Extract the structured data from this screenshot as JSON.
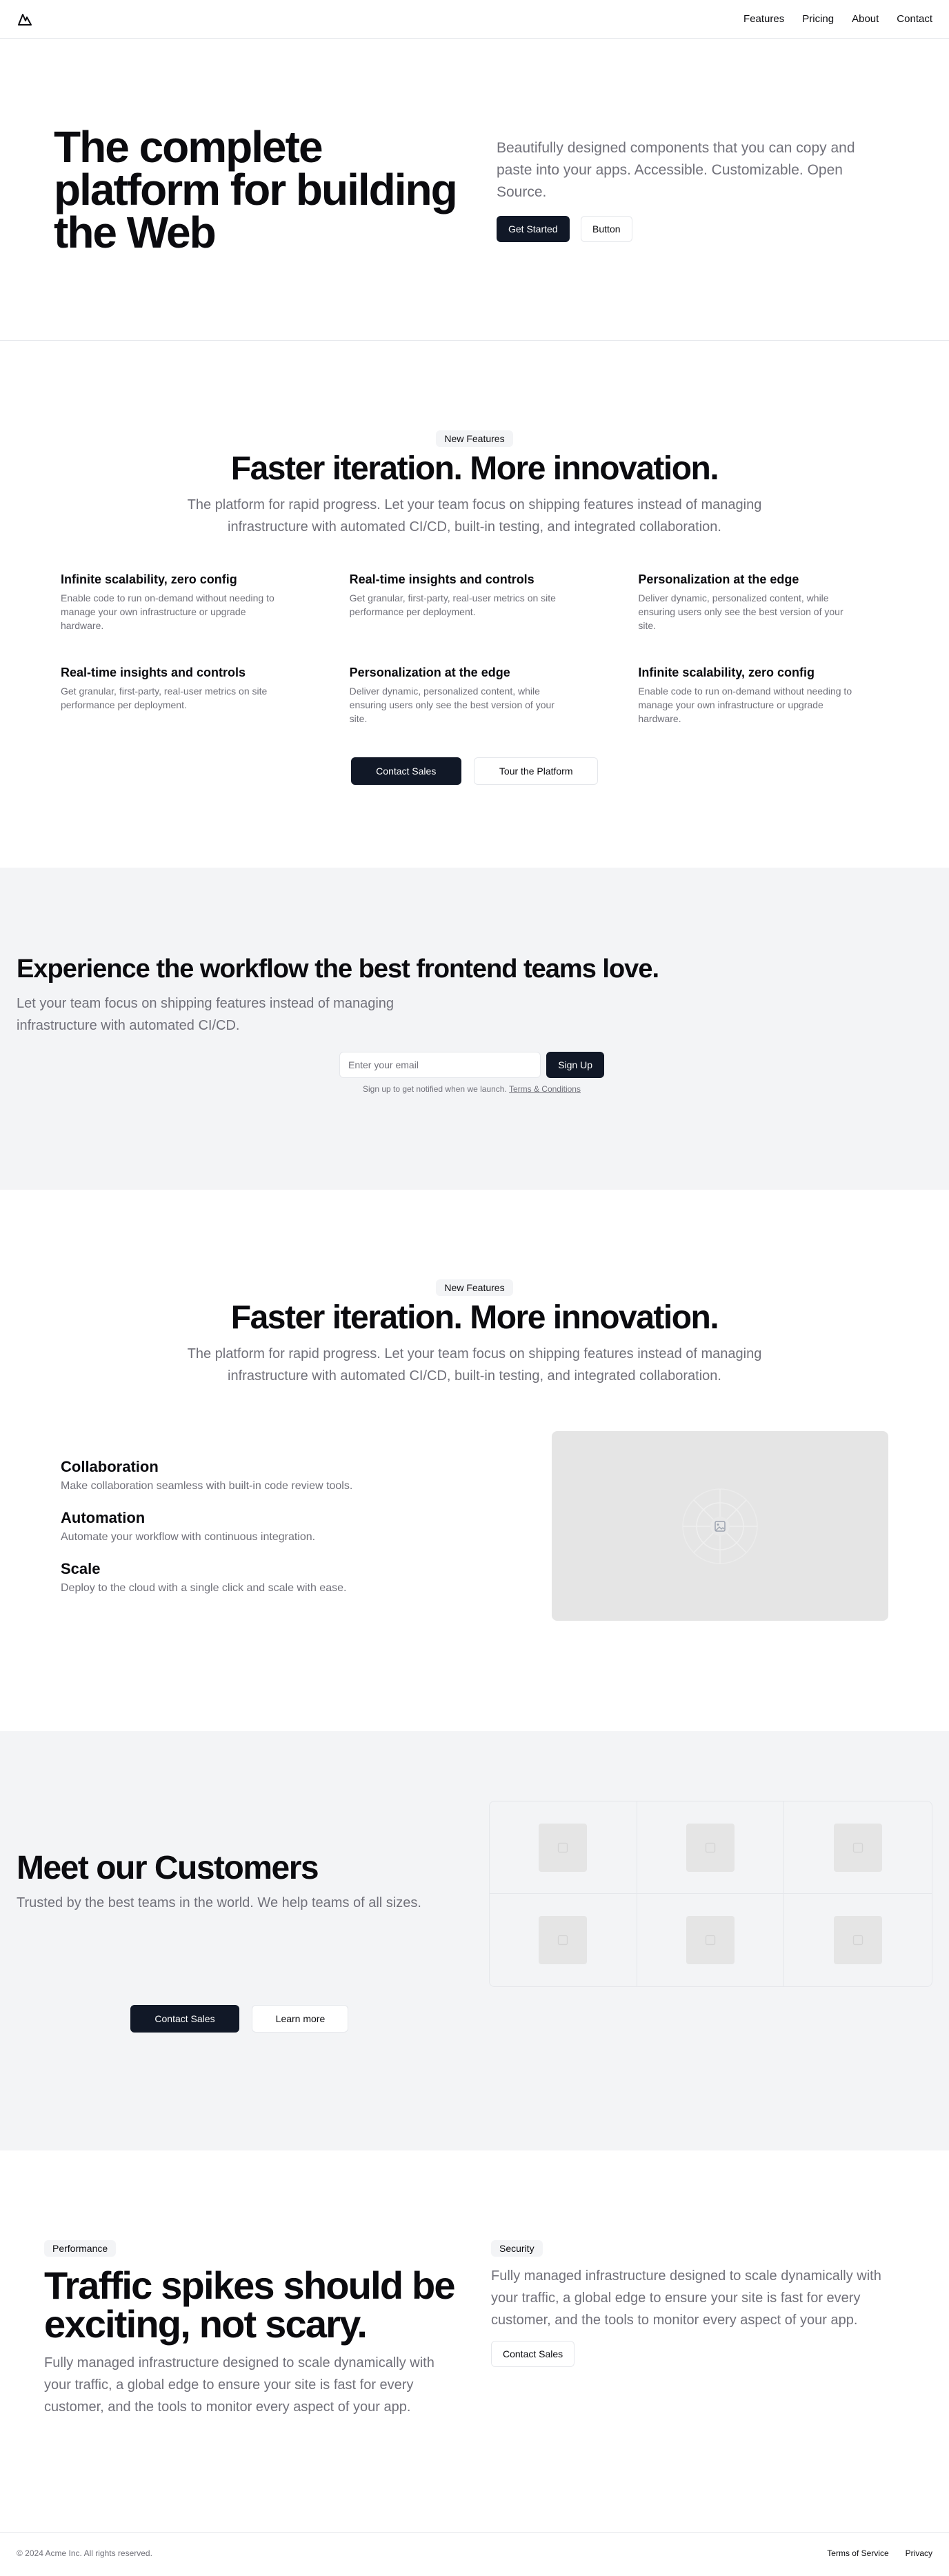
{
  "header": {
    "logo_icon": "mountain-icon",
    "nav": [
      "Features",
      "Pricing",
      "About",
      "Contact"
    ]
  },
  "hero": {
    "title": "The complete platform for building the Web",
    "description": "Beautifully designed components that you can copy and paste into your apps. Accessible. Customizable. Open Source.",
    "primary_label": "Get Started",
    "secondary_label": "Button"
  },
  "features1": {
    "badge": "New Features",
    "title": "Faster iteration. More innovation.",
    "subtitle": "The platform for rapid progress. Let your team focus on shipping features instead of managing infrastructure with automated CI/CD, built-in testing, and integrated collaboration.",
    "items": [
      {
        "title": "Infinite scalability, zero config",
        "text": "Enable code to run on-demand without needing to manage your own infrastructure or upgrade hardware."
      },
      {
        "title": "Real-time insights and controls",
        "text": "Get granular, first-party, real-user metrics on site performance per deployment."
      },
      {
        "title": "Personalization at the edge",
        "text": "Deliver dynamic, personalized content, while ensuring users only see the best version of your site."
      },
      {
        "title": "Real-time insights and controls",
        "text": "Get granular, first-party, real-user metrics on site performance per deployment."
      },
      {
        "title": "Personalization at the edge",
        "text": "Deliver dynamic, personalized content, while ensuring users only see the best version of your site."
      },
      {
        "title": "Infinite scalability, zero config",
        "text": "Enable code to run on-demand without needing to manage your own infrastructure or upgrade hardware."
      }
    ],
    "primary_label": "Contact Sales",
    "secondary_label": "Tour the Platform"
  },
  "workflow": {
    "title": "Experience the workflow the best frontend teams love.",
    "subtitle": "Let your team focus on shipping features instead of managing infrastructure with automated CI/CD.",
    "email_placeholder": "Enter your email",
    "signup_label": "Sign Up",
    "fine_print": "Sign up to get notified when we launch.",
    "terms_label": "Terms & Conditions"
  },
  "features2": {
    "badge": "New Features",
    "title": "Faster iteration. More innovation.",
    "subtitle": "The platform for rapid progress. Let your team focus on shipping features instead of managing infrastructure with automated CI/CD, built-in testing, and integrated collaboration.",
    "items": [
      {
        "title": "Collaboration",
        "text": "Make collaboration seamless with built-in code review tools."
      },
      {
        "title": "Automation",
        "text": "Automate your workflow with continuous integration."
      },
      {
        "title": "Scale",
        "text": "Deploy to the cloud with a single click and scale with ease."
      }
    ],
    "image_icon": "image-placeholder-icon"
  },
  "customers": {
    "title": "Meet our Customers",
    "subtitle": "Trusted by the best teams in the world. We help teams of all sizes.",
    "primary_label": "Contact Sales",
    "secondary_label": "Learn more",
    "logo_icon": "image-placeholder-icon"
  },
  "performance": {
    "left_badge": "Performance",
    "title": "Traffic spikes should be exciting, not scary.",
    "left_text": "Fully managed infrastructure designed to scale dynamically with your traffic, a global edge to ensure your site is fast for every customer, and the tools to monitor every aspect of your app.",
    "right_badge": "Security",
    "right_text": "Fully managed infrastructure designed to scale dynamically with your traffic, a global edge to ensure your site is fast for every customer, and the tools to monitor every aspect of your app.",
    "cta_label": "Contact Sales"
  },
  "footer": {
    "copyright": "© 2024 Acme Inc. All rights reserved.",
    "links": [
      "Terms of Service",
      "Privacy"
    ]
  },
  "colors": {
    "primary": "#111827",
    "muted_text": "#71717a",
    "section_bg": "#f3f4f6",
    "border": "#e5e7eb",
    "placeholder": "#e5e5e5"
  }
}
